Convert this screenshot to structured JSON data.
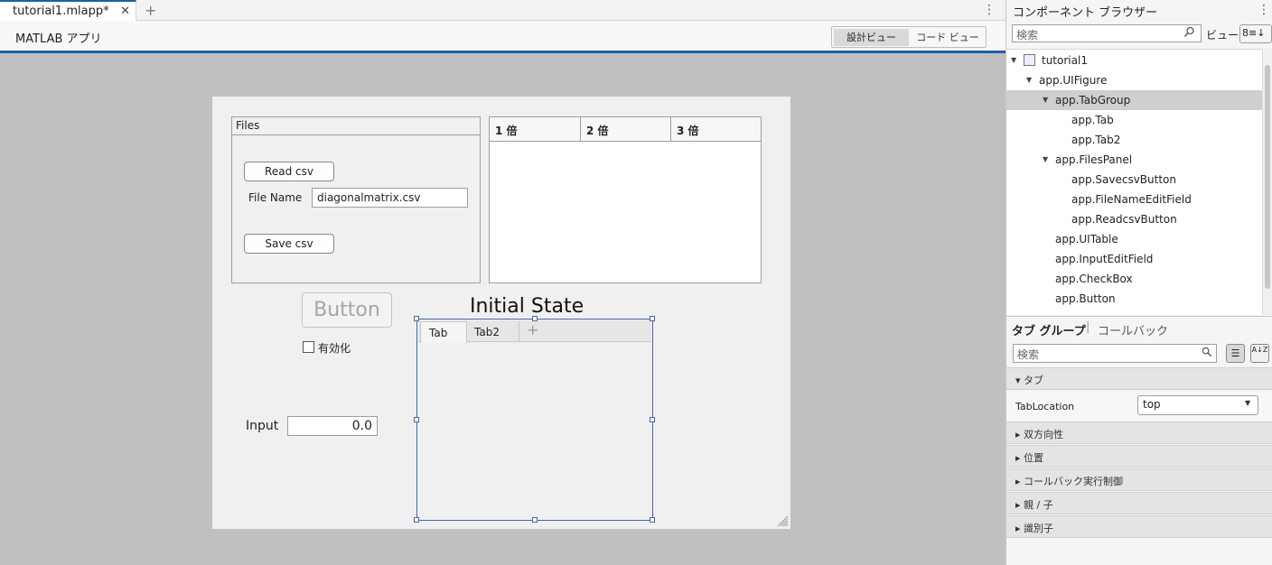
{
  "document_tab": {
    "title": "tutorial1.mlapp*",
    "close": "✕",
    "add": "+"
  },
  "toolbar": {
    "app_label": "MATLAB アプリ",
    "design_view": "設計ビュー",
    "code_view": "コード ビュー"
  },
  "canvas": {
    "files_panel": {
      "title": "Files",
      "read_button": "Read csv",
      "filename_label": "File Name",
      "filename_value": "diagonalmatrix.csv",
      "save_button": "Save csv"
    },
    "table": {
      "columns": [
        "1 倍",
        "2 倍",
        "3 倍"
      ]
    },
    "button_label": "Button",
    "checkbox_label": "有効化",
    "state_label": "Initial State",
    "tabgroup": {
      "tabs": [
        "Tab",
        "Tab2"
      ],
      "add": "+"
    },
    "input_label": "Input",
    "input_value": "0.0"
  },
  "component_browser": {
    "title": "コンポーネント ブラウザー",
    "search_placeholder": "検索",
    "view_label": "ビュー:",
    "view_select": "8≡↓",
    "tree": [
      {
        "label": "tutorial1",
        "level": 0,
        "expanded": true,
        "selected": false
      },
      {
        "label": "app.UIFigure",
        "level": 1,
        "expanded": true,
        "selected": false
      },
      {
        "label": "app.TabGroup",
        "level": 2,
        "expanded": true,
        "selected": true
      },
      {
        "label": "app.Tab",
        "level": 3,
        "expanded": null,
        "selected": false
      },
      {
        "label": "app.Tab2",
        "level": 3,
        "expanded": null,
        "selected": false
      },
      {
        "label": "app.FilesPanel",
        "level": 2,
        "expanded": true,
        "selected": false
      },
      {
        "label": "app.SavecsvButton",
        "level": 3,
        "expanded": null,
        "selected": false
      },
      {
        "label": "app.FileNameEditField",
        "level": 3,
        "expanded": null,
        "selected": false
      },
      {
        "label": "app.ReadcsvButton",
        "level": 3,
        "expanded": null,
        "selected": false
      },
      {
        "label": "app.UITable",
        "level": 2,
        "expanded": null,
        "selected": false
      },
      {
        "label": "app.InputEditField",
        "level": 2,
        "expanded": null,
        "selected": false
      },
      {
        "label": "app.CheckBox",
        "level": 2,
        "expanded": null,
        "selected": false
      },
      {
        "label": "app.Button",
        "level": 2,
        "expanded": null,
        "selected": false
      }
    ]
  },
  "inspector": {
    "tab_props": "タブ グループ",
    "separator": "|",
    "tab_callbacks": "コールバック",
    "search_placeholder": "検索",
    "sort_az": "A↓Z",
    "sections": {
      "tab": "タブ",
      "interactivity": "双方向性",
      "position": "位置",
      "callback_execution": "コールバック実行制御",
      "parent_child": "親 / 子",
      "identifiers": "識別子"
    },
    "tablocation_label": "TabLocation",
    "tablocation_value": "top"
  }
}
